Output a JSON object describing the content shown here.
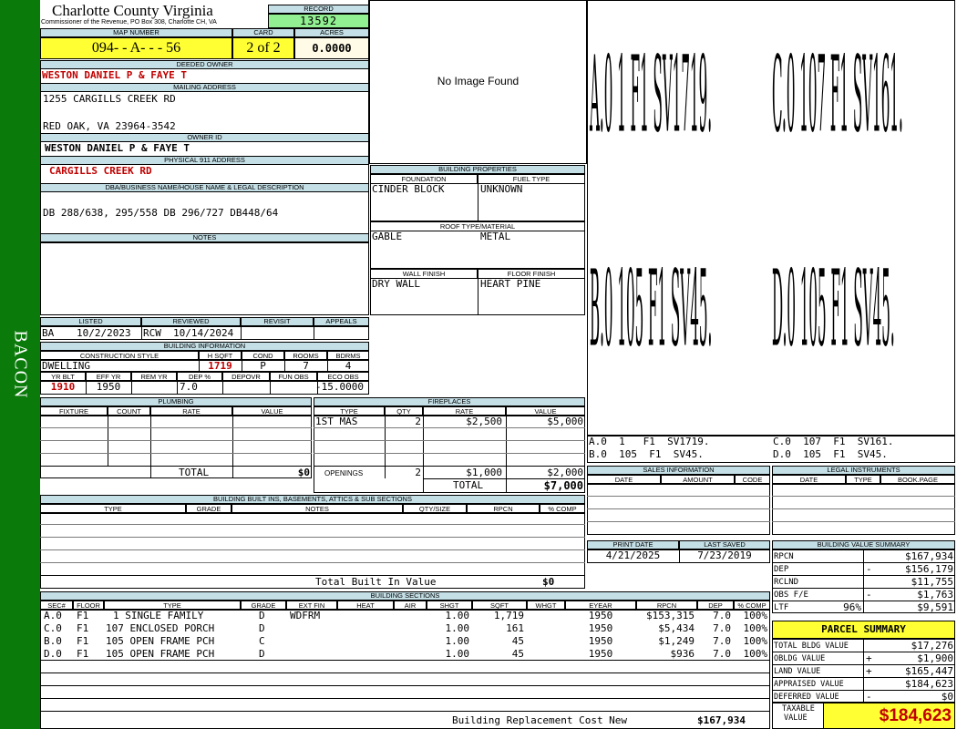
{
  "side_label": "BACON",
  "header": {
    "county": "Charlotte County Virginia",
    "commissioner": "Commissioner of the Revenue, PO Box 308, Charlotte CH, VA",
    "record_label": "RECORD",
    "record": "13592",
    "map_label": "MAP NUMBER",
    "map": "094- - A- - - 56",
    "card_label": "CARD",
    "card": "2 of 2",
    "acres_label": "ACRES",
    "acres": "0.0000"
  },
  "owner": {
    "deeded_label": "DEEDED OWNER",
    "deeded": "WESTON DANIEL P & FAYE T",
    "mailing_label": "MAILING ADDRESS",
    "addr1": "1255 CARGILLS CREEK RD",
    "addr2": "RED OAK, VA 23964-3542",
    "owner_id_label": "OWNER ID",
    "owner_id": "WESTON DANIEL P & FAYE T",
    "physical_label": "PHYSICAL 911 ADDRESS",
    "physical": "CARGILLS CREEK RD",
    "dba_label": "DBA/BUSINESS NAME/HOUSE NAME & LEGAL DESCRIPTION",
    "dba": "DB 288/638, 295/558  DB 296/727 DB448/64",
    "notes_label": "NOTES"
  },
  "image": {
    "no_image": "No Image Found"
  },
  "properties": {
    "title": "BUILDING PROPERTIES",
    "foundation_label": "FOUNDATION",
    "foundation": "CINDER BLOCK",
    "fuel_label": "FUEL TYPE",
    "fuel": "UNKNOWN",
    "roof_label": "ROOF TYPE/MATERIAL",
    "roof_type": "GABLE",
    "roof_material": "METAL",
    "wall_label": "WALL FINISH",
    "wall": "DRY WALL",
    "floor_label": "FLOOR FINISH",
    "floor": "HEART PINE"
  },
  "sketch": {
    "labels": [
      "A.0  1   F1  SV1719.",
      "C.0  107  F1  SV161.",
      "B.0  105  F1  SV45.",
      "D.0  105  F1  SV45."
    ]
  },
  "listing": {
    "listed_label": "LISTED",
    "listed_by": "BA",
    "listed_date": "10/2/2023",
    "reviewed_label": "REVIEWED",
    "reviewed_by": "RCW",
    "reviewed_date": "10/14/2024",
    "revisit_label": "REVISIT",
    "appeals_label": "APPEALS"
  },
  "bldg_info": {
    "title": "BUILDING INFORMATION",
    "style_label": "CONSTRUCTION STYLE",
    "style": "DWELLING",
    "hsqft_label": "H SQFT",
    "hsqft": "1719",
    "cond_label": "COND",
    "cond": "P",
    "rooms_label": "ROOMS",
    "rooms": "7",
    "bdrms_label": "BDRMS",
    "bdrms": "4",
    "yrblt_label": "YR BLT",
    "yrblt": "1910",
    "effyr_label": "EFF YR",
    "effyr": "1950",
    "remyr_label": "REM YR",
    "remyr": "",
    "dep_label": "DEP %",
    "dep": "7.0",
    "depovr_label": "DEPOVR",
    "depovr": "",
    "funobs_label": "FUN OBS",
    "funobs": "",
    "ecoobs_label": "ECO OBS",
    "ecoobs": "-15.0000"
  },
  "plumbing": {
    "title": "PLUMBING",
    "cols": [
      "FIXTURE",
      "COUNT",
      "RATE",
      "VALUE"
    ],
    "total_label": "TOTAL",
    "total": "$0"
  },
  "fireplaces": {
    "title": "FIREPLACES",
    "cols": [
      "TYPE",
      "QTY",
      "RATE",
      "VALUE"
    ],
    "row": {
      "type": "1ST MAS",
      "qty": "2",
      "rate": "$2,500",
      "value": "$5,000"
    },
    "openings_label": "OPENINGS",
    "openings_qty": "2",
    "openings_rate": "$1,000",
    "openings_value": "$2,000",
    "total_label": "TOTAL",
    "total": "$7,000"
  },
  "built_ins": {
    "title": "BUILDING BUILT INS, BASEMENTS, ATTICS & SUB SECTIONS",
    "cols": [
      "TYPE",
      "GRADE",
      "NOTES",
      "QTY/SIZE",
      "RPCN",
      "% COMP"
    ],
    "total_label": "Total Built In Value",
    "total": "$0"
  },
  "sales": {
    "title": "SALES INFORMATION",
    "cols": [
      "DATE",
      "AMOUNT",
      "CODE"
    ]
  },
  "legal": {
    "title": "LEGAL INSTRUMENTS",
    "cols": [
      "DATE",
      "TYPE",
      "BOOK.PAGE"
    ]
  },
  "print": {
    "print_label": "PRINT DATE",
    "print_date": "4/21/2025",
    "saved_label": "LAST SAVED",
    "saved_date": "7/23/2019"
  },
  "value_summary": {
    "title": "BUILDING VALUE SUMMARY",
    "rows": [
      {
        "label": "RPCN",
        "sign": "",
        "value": "$167,934"
      },
      {
        "label": "DEP",
        "sign": "-",
        "value": "$156,179"
      },
      {
        "label": "RCLND",
        "sign": "",
        "value": "$11,755"
      },
      {
        "label": "OBS F/E",
        "sign": "-",
        "value": "$1,763"
      },
      {
        "label": "LTF",
        "sign": "96%",
        "value": "$9,591"
      }
    ]
  },
  "parcel": {
    "title": "PARCEL SUMMARY",
    "rows": [
      {
        "label": "TOTAL BLDG VALUE",
        "sign": "",
        "value": "$17,276"
      },
      {
        "label": "OBLDG VALUE",
        "sign": "+",
        "value": "$1,900"
      },
      {
        "label": "LAND VALUE",
        "sign": "+",
        "value": "$165,447"
      },
      {
        "label": "APPRAISED VALUE",
        "sign": "",
        "value": "$184,623"
      },
      {
        "label": "DEFERRED VALUE",
        "sign": "-",
        "value": "$0"
      }
    ],
    "taxable_label1": "TAXABLE",
    "taxable_label2": "VALUE",
    "taxable": "$184,623"
  },
  "sections": {
    "title": "BUILDING SECTIONS",
    "cols": [
      "SEC#",
      "FLOOR",
      "TYPE",
      "GRADE",
      "EXT FIN",
      "HEAT",
      "AIR",
      "SHGT",
      "SQFT",
      "WHGT",
      "EYEAR",
      "RPCN",
      "DEP",
      "% COMP"
    ],
    "rows": [
      {
        "sec": "A.0",
        "floor": "F1",
        "type": "1 SINGLE FAMILY",
        "grade": "D",
        "ext": "WDFRM",
        "heat": "",
        "air": "",
        "shgt": "1.00",
        "sqft": "1,719",
        "whgt": "",
        "eyear": "1950",
        "rpcn": "$153,315",
        "dep": "7.0",
        "comp": "100%"
      },
      {
        "sec": "C.0",
        "floor": "F1",
        "type": "107 ENCLOSED PORCH",
        "grade": "D",
        "ext": "",
        "heat": "",
        "air": "",
        "shgt": "1.00",
        "sqft": "161",
        "whgt": "",
        "eyear": "1950",
        "rpcn": "$5,434",
        "dep": "7.0",
        "comp": "100%"
      },
      {
        "sec": "B.0",
        "floor": "F1",
        "type": "105 OPEN FRAME PCH",
        "grade": "C",
        "ext": "",
        "heat": "",
        "air": "",
        "shgt": "1.00",
        "sqft": "45",
        "whgt": "",
        "eyear": "1950",
        "rpcn": "$1,249",
        "dep": "7.0",
        "comp": "100%"
      },
      {
        "sec": "D.0",
        "floor": "F1",
        "type": "105 OPEN FRAME PCH",
        "grade": "D",
        "ext": "",
        "heat": "",
        "air": "",
        "shgt": "1.00",
        "sqft": "45",
        "whgt": "",
        "eyear": "1950",
        "rpcn": "$936",
        "dep": "7.0",
        "comp": "100%"
      }
    ],
    "rcn_label": "Building Replacement Cost New",
    "rcn": "$167,934"
  }
}
